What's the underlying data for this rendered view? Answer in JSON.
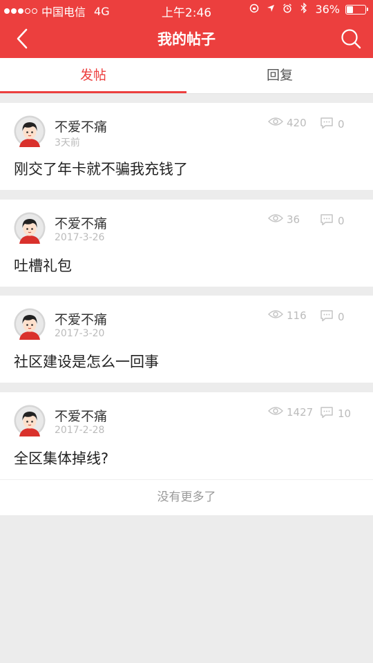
{
  "status_bar": {
    "carrier": "中国电信",
    "network": "4G",
    "time": "上午2:46",
    "battery": "36%",
    "battery_level": 0.36,
    "icons": [
      "signal-dots-icon",
      "rotation-lock-icon",
      "location-arrow-icon",
      "alarm-icon",
      "bluetooth-icon",
      "battery-icon"
    ]
  },
  "navbar": {
    "title": "我的帖子",
    "icons": [
      "back-chevron-icon",
      "search-icon"
    ]
  },
  "tabs": [
    {
      "label": "发帖",
      "active": true
    },
    {
      "label": "回复",
      "active": false
    }
  ],
  "posts": [
    {
      "author": "不爱不痛",
      "date": "3天前",
      "views": "420",
      "comments": "0",
      "title": "刚交了年卡就不骗我充钱了"
    },
    {
      "author": "不爱不痛",
      "date": "2017-3-26",
      "views": "36",
      "comments": "0",
      "title": "吐槽礼包"
    },
    {
      "author": "不爱不痛",
      "date": "2017-3-20",
      "views": "116",
      "comments": "0",
      "title": "社区建设是怎么一回事"
    },
    {
      "author": "不爱不痛",
      "date": "2017-2-28",
      "views": "1427",
      "comments": "10",
      "title": "全区集体掉线?"
    }
  ],
  "footer": {
    "no_more": "没有更多了"
  },
  "colors": {
    "accent": "#ec3f3e",
    "background": "#ececec",
    "meta_text": "#bbbbbb"
  }
}
